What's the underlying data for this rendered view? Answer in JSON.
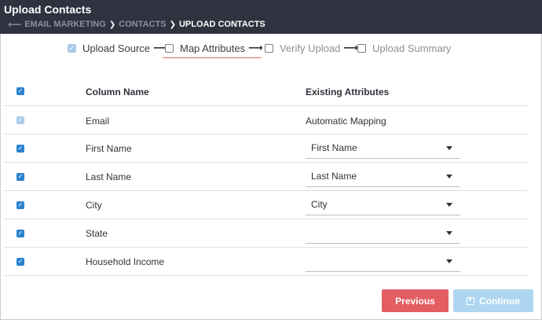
{
  "header": {
    "title": "Upload Contacts",
    "breadcrumb": [
      "EMAIL MARKETING",
      "CONTACTS",
      "UPLOAD CONTACTS"
    ]
  },
  "steps": [
    {
      "label": "Upload Source",
      "checked": true,
      "state": "done"
    },
    {
      "label": "Map Attributes",
      "checked": false,
      "state": "active"
    },
    {
      "label": "Verify Upload",
      "checked": false,
      "state": "pending"
    },
    {
      "label": "Upload Summary",
      "checked": false,
      "state": "pending"
    }
  ],
  "table": {
    "headers": {
      "column_name": "Column Name",
      "existing_attributes": "Existing Attributes"
    },
    "rows": [
      {
        "column": "Email",
        "attribute": "Automatic Mapping",
        "type": "text",
        "locked": true
      },
      {
        "column": "First Name",
        "attribute": "First Name",
        "type": "select"
      },
      {
        "column": "Last Name",
        "attribute": "Last Name",
        "type": "select"
      },
      {
        "column": "City",
        "attribute": "City",
        "type": "select"
      },
      {
        "column": "State",
        "attribute": "",
        "type": "select"
      },
      {
        "column": "Household Income",
        "attribute": "",
        "type": "select"
      }
    ]
  },
  "buttons": {
    "previous": "Previous",
    "continue": "Continue"
  },
  "colors": {
    "header_bg": "#2f3340",
    "primary_check": "#2b82cf",
    "previous": "#e35d62",
    "continue_disabled": "#aed6f1",
    "active_step_underline": "#d96566"
  }
}
